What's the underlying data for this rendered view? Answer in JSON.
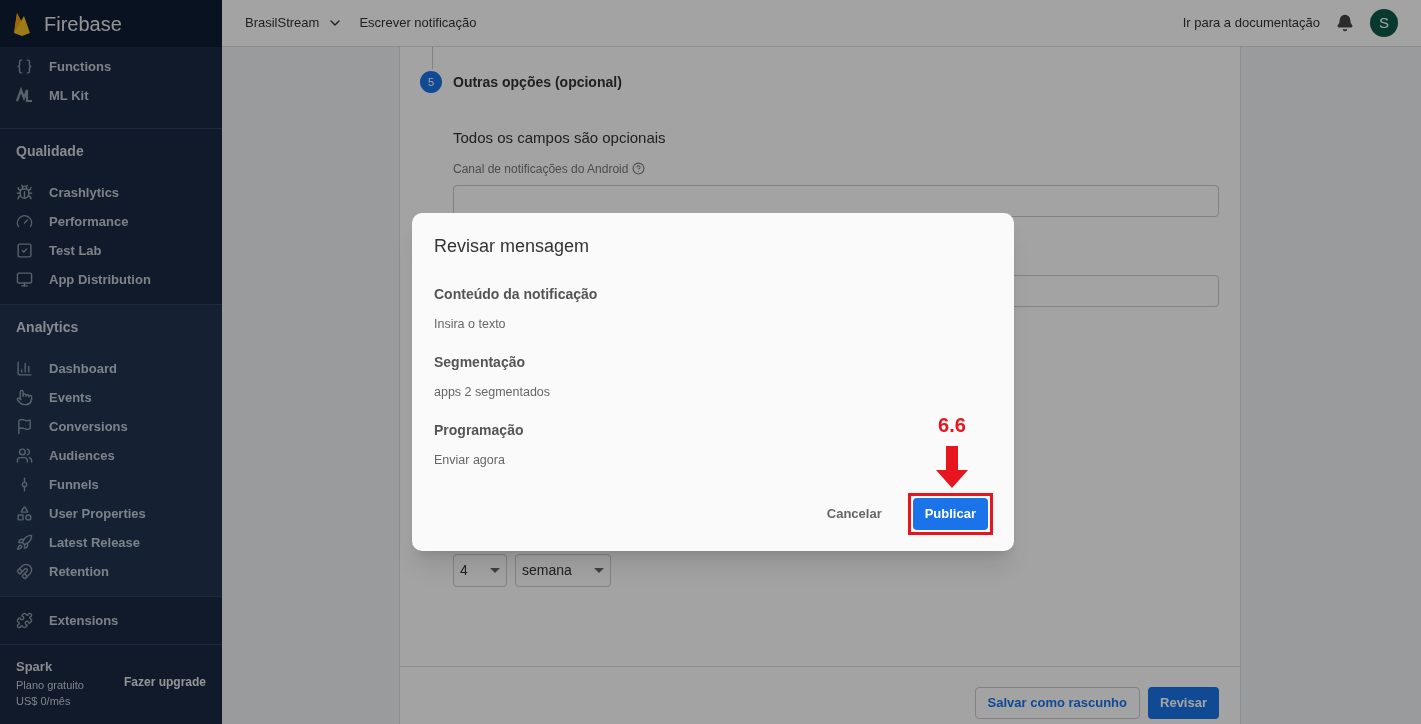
{
  "app": {
    "name": "Firebase"
  },
  "sidebar": {
    "top_items": [
      "Functions",
      "ML Kit"
    ],
    "sections": [
      {
        "title": "Qualidade",
        "items": [
          "Crashlytics",
          "Performance",
          "Test Lab",
          "App Distribution"
        ]
      },
      {
        "title": "Analytics",
        "items": [
          "Dashboard",
          "Events",
          "Conversions",
          "Audiences",
          "Funnels",
          "User Properties",
          "Latest Release",
          "Retention"
        ]
      }
    ],
    "extensions": "Extensions",
    "plan": {
      "name": "Spark",
      "description": "Plano gratuito",
      "price": "US$ 0/mês",
      "upgrade": "Fazer upgrade"
    }
  },
  "topbar": {
    "project": "BrasilStream",
    "page": "Escrever notificação",
    "docs_link": "Ir para a documentação",
    "avatar": "S"
  },
  "step": {
    "number": "5",
    "title": "Outras opções (opcional)",
    "subtitle": "Todos os campos são opcionais",
    "fields": [
      {
        "kind": "labeled",
        "label": "Canal de notificações do Android"
      },
      {
        "kind": "bare"
      }
    ],
    "expiry": {
      "amount": "4",
      "unit": "semana"
    }
  },
  "footer_buttons": [
    {
      "label": "Salvar como rascunho",
      "kind": "outlined"
    },
    {
      "label": "Revisar",
      "kind": "primary"
    }
  ],
  "dialog": {
    "title": "Revisar mensagem",
    "sections": [
      {
        "heading": "Conteúdo da notificação",
        "value": "Insira o texto"
      },
      {
        "heading": "Segmentação",
        "value": "apps 2 segmentados"
      },
      {
        "heading": "Programação",
        "value": "Enviar agora"
      }
    ],
    "buttons": [
      {
        "label": "Cancelar",
        "kind": "text",
        "highlighted": false
      },
      {
        "label": "Publicar",
        "kind": "primary",
        "highlighted": true
      }
    ]
  },
  "annotation": {
    "label": "6.6"
  }
}
